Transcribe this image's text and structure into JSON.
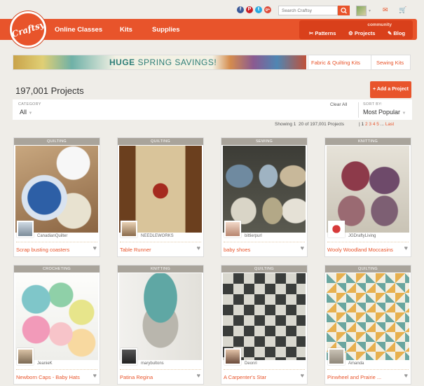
{
  "header": {
    "logo_text": "Craftsy",
    "nav": [
      "Online Classes",
      "Kits",
      "Supplies"
    ],
    "search_placeholder": "Search Craftsy",
    "social": [
      "f",
      "P",
      "t",
      "g+"
    ],
    "community": {
      "label": "community",
      "links": [
        "Patterns",
        "Projects",
        "Blog"
      ]
    }
  },
  "banner": {
    "huge": "HUGE",
    "text": "SPRING SAVINGS!",
    "links": [
      "Fabric & Quilting Kits",
      "Sewing Kits"
    ]
  },
  "projects": {
    "count_label": "197,001 Projects",
    "add_label": "+ Add a Project"
  },
  "filters": {
    "category_label": "CATEGORY",
    "category_value": "All",
    "clear_label": "Clear All",
    "sort_label": "SORT BY:",
    "sort_value": "Most Popular"
  },
  "pagination": {
    "showing": "Showing 1",
    "range": "20 of 197,001 Projects",
    "pages": [
      "1",
      "2",
      "3",
      "4",
      "5",
      "...",
      "Last"
    ]
  },
  "cards": [
    {
      "category": "QUILTING",
      "user": "CanadianQuilter",
      "title": "Scrap busting coasters"
    },
    {
      "category": "QUILTING",
      "user": "NEEDLEWORKS",
      "title": "Table Runner"
    },
    {
      "category": "SEWING",
      "user": "bittierpurl",
      "title": "baby shoes"
    },
    {
      "category": "KNITTING",
      "user": "JGDraftyLiving",
      "title": "Wooly Woodland Moccasins"
    },
    {
      "category": "CROCHETING",
      "user": "JeanieK",
      "title": "Newborn Caps - Baby Hats"
    },
    {
      "category": "KNITTING",
      "user": "marybultons",
      "title": "Patina Regina"
    },
    {
      "category": "QUILTING",
      "user": "Deonri",
      "title": "A Carpenter's Star"
    },
    {
      "category": "QUILTING",
      "user": "Amanda",
      "title": "Pinwheel and Prairie ..."
    }
  ],
  "colors": {
    "brand": "#e8542b",
    "category_bar": "#a9a49b",
    "background": "#efede8"
  }
}
